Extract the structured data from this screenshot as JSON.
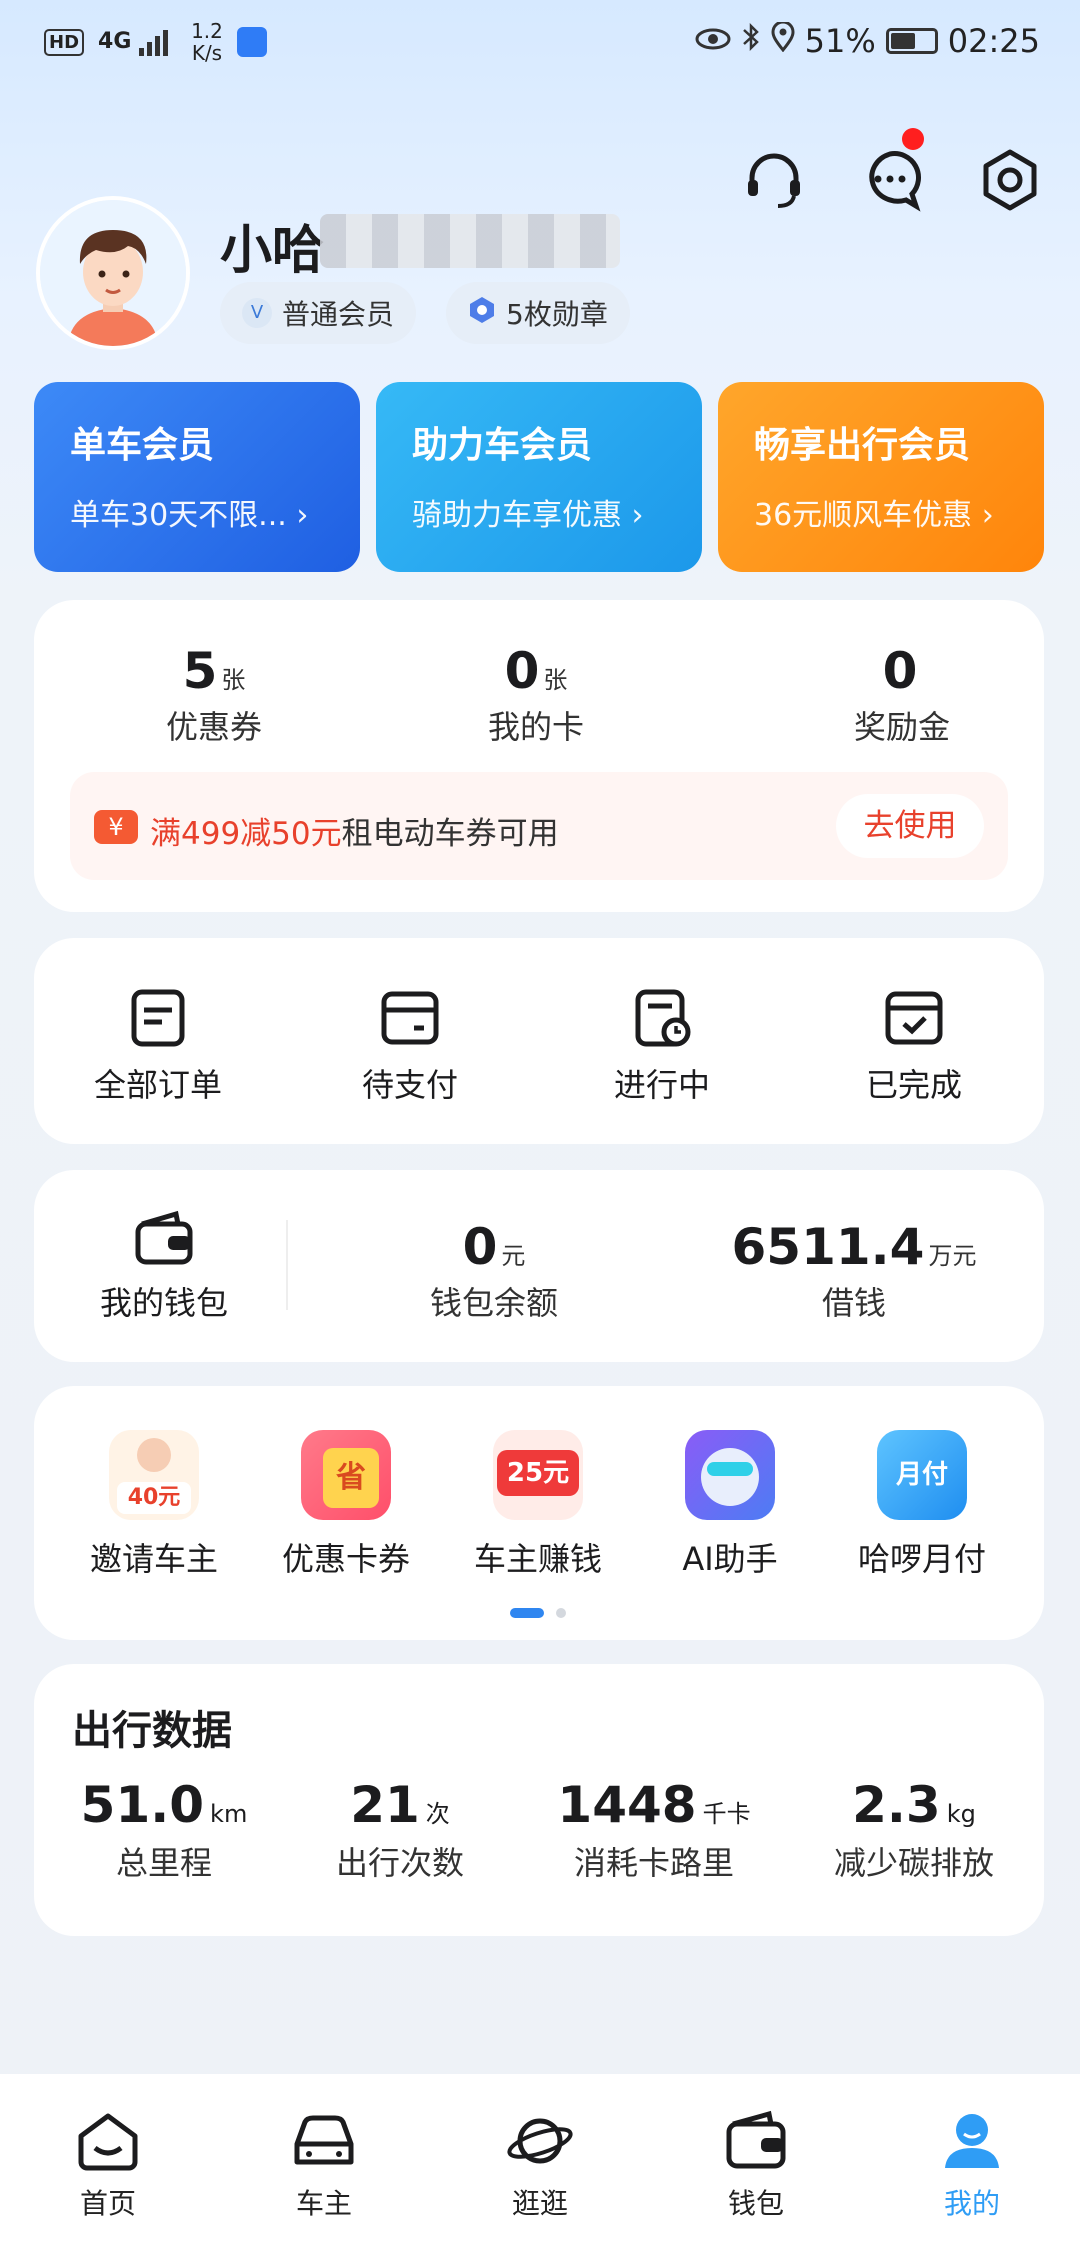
{
  "status_bar": {
    "network": "HD",
    "signal": "4G",
    "speed_value": "1.2",
    "speed_unit": "K/s",
    "battery": "51%",
    "time": "02:25"
  },
  "profile": {
    "name": "小哈",
    "member_level": "普通会员",
    "badges": "5枚勋章"
  },
  "membership_cards": [
    {
      "title": "单车会员",
      "subtitle": "单车30天不限...",
      "color": "#2f74f0"
    },
    {
      "title": "助力车会员",
      "subtitle": "骑助力车享优惠",
      "color": "#22a8f0"
    },
    {
      "title": "畅享出行会员",
      "subtitle": "36元顺风车优惠",
      "color": "#ff8a10"
    }
  ],
  "assets": {
    "items": [
      {
        "value": "5",
        "unit": "张",
        "label": "优惠券"
      },
      {
        "value": "0",
        "unit": "张",
        "label": "我的卡"
      },
      {
        "value": "0",
        "unit": "",
        "label": "奖励金"
      }
    ],
    "promo": {
      "icon": "¥",
      "highlight": "满499减50元",
      "text": "租电动车券可用",
      "button": "去使用"
    }
  },
  "orders": [
    {
      "label": "全部订单",
      "icon": "list-icon"
    },
    {
      "label": "待支付",
      "icon": "card-icon"
    },
    {
      "label": "进行中",
      "icon": "clock-doc-icon"
    },
    {
      "label": "已完成",
      "icon": "check-calendar-icon"
    }
  ],
  "wallet": {
    "label": "我的钱包",
    "balance": {
      "value": "0",
      "unit": "元",
      "label": "钱包余额"
    },
    "loan": {
      "value": "6511.4",
      "unit": "万元",
      "label": "借钱"
    }
  },
  "features": [
    {
      "label": "邀请车主",
      "badge": "40元"
    },
    {
      "label": "优惠卡券",
      "badge": "省"
    },
    {
      "label": "车主赚钱",
      "badge": "25元"
    },
    {
      "label": "AI助手",
      "badge": ""
    },
    {
      "label": "哈啰月付",
      "badge": "月付"
    }
  ],
  "travel": {
    "title": "出行数据",
    "items": [
      {
        "value": "51.0",
        "unit": "km",
        "label": "总里程"
      },
      {
        "value": "21",
        "unit": "次",
        "label": "出行次数"
      },
      {
        "value": "1448",
        "unit": "千卡",
        "label": "消耗卡路里"
      },
      {
        "value": "2.3",
        "unit": "kg",
        "label": "减少碳排放"
      }
    ]
  },
  "nav": [
    {
      "label": "首页",
      "icon": "home-icon"
    },
    {
      "label": "车主",
      "icon": "car-icon"
    },
    {
      "label": "逛逛",
      "icon": "planet-icon"
    },
    {
      "label": "钱包",
      "icon": "wallet-icon"
    },
    {
      "label": "我的",
      "icon": "user-icon",
      "active": true
    }
  ],
  "colors": {
    "accent": "#2f74f0",
    "red": "#e8412c",
    "active_nav": "#2f9df5"
  }
}
